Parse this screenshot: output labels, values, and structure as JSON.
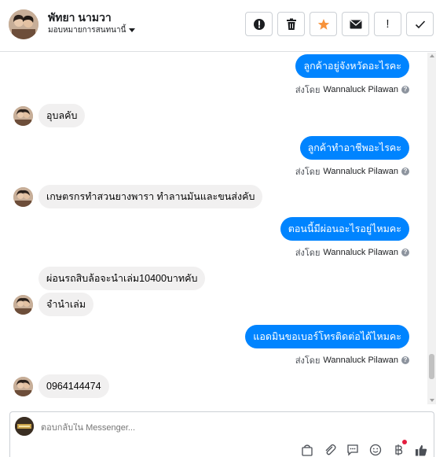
{
  "header": {
    "name": "พัทยา นามวา",
    "assign_label": "มอบหมายการสนทนานี้",
    "actions": [
      {
        "icon": "alert-circle-icon",
        "label": "!"
      },
      {
        "icon": "trash-icon",
        "label": ""
      },
      {
        "icon": "star-icon",
        "label": ""
      },
      {
        "icon": "envelope-icon",
        "label": ""
      },
      {
        "icon": "exclamation-icon",
        "label": "!"
      },
      {
        "icon": "check-icon",
        "label": ""
      }
    ]
  },
  "colors": {
    "outgoing_bubble": "#0084ff",
    "incoming_bubble": "#f1f0f0",
    "star": "#f7923a"
  },
  "sent_by": {
    "prefix": "ส่งโดย",
    "agent": "Wannaluck Pilawan"
  },
  "messages": [
    {
      "direction": "out",
      "text": "ลูกค้าอยู่จังหวัดอะไรคะ"
    },
    {
      "direction": "in",
      "text": "อุบลคับ"
    },
    {
      "direction": "out",
      "text": "ลูกค้าทำอาชีพอะไรคะ"
    },
    {
      "direction": "in",
      "text": "เกษตรกรทำสวนยางพารา ทำลานมันและขนส่งคับ"
    },
    {
      "direction": "out",
      "text": "ตอนนี้มีผ่อนอะไรอยู่ไหมคะ"
    },
    {
      "direction": "in",
      "text": "ผ่อนรถสิบล้อจะนำเล่ม10400บาทคับ"
    },
    {
      "direction": "in",
      "text": "จำนำเล่ม"
    },
    {
      "direction": "out",
      "text": "แอดมินขอเบอร์โทรติดต่อได้ไหมคะ"
    },
    {
      "direction": "in",
      "text": "0964144474"
    }
  ],
  "composer": {
    "placeholder": "ตอบกลับใน Messenger..."
  }
}
